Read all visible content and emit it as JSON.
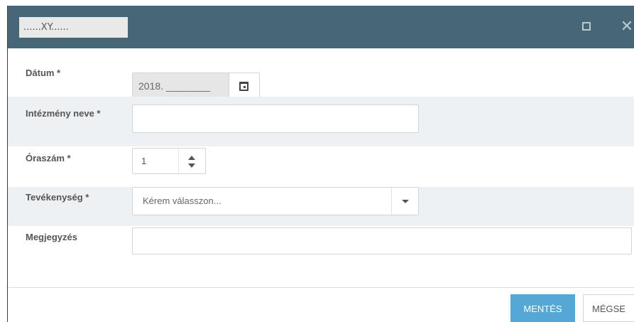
{
  "dialog": {
    "title": "......XY......",
    "colors": {
      "header": "#476777",
      "row_shade": "#eef1f4",
      "primary": "#55a7d6"
    },
    "icons": {
      "maximize": "maximize-icon",
      "close": "close-icon",
      "calendar": "calendar-icon"
    },
    "close_glyph": "✕"
  },
  "form": {
    "date": {
      "label": "Dátum *",
      "value": "2018. ________"
    },
    "institution": {
      "label": "Intézmény neve *",
      "value": ""
    },
    "hours": {
      "label": "Óraszám *",
      "value": "1"
    },
    "activity": {
      "label": "Tevékenység *",
      "placeholder": "Kérem válasszon..."
    },
    "note": {
      "label": "Megjegyzés",
      "value": ""
    }
  },
  "footer": {
    "save_label": "MENTÉS",
    "cancel_label": "MÉGSE"
  }
}
